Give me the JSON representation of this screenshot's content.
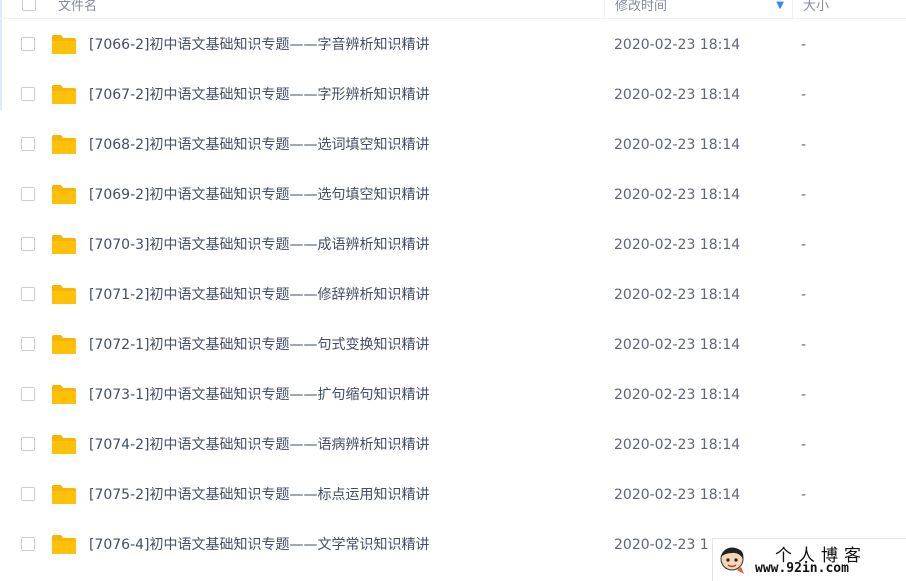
{
  "header": {
    "name_label": "文件名",
    "mtime_label": "修改时间",
    "size_label": "大小",
    "sort_icon": "sort-down-icon"
  },
  "colors": {
    "folder": "#ffc107",
    "folder_back": "#f7b500",
    "text": "#424e67",
    "accent": "#2d8cf0"
  },
  "files": [
    {
      "name": "[7066-2]初中语文基础知识专题——字音辨析知识精讲",
      "mtime": "2020-02-23 18:14",
      "size": "-"
    },
    {
      "name": "[7067-2]初中语文基础知识专题——字形辨析知识精讲",
      "mtime": "2020-02-23 18:14",
      "size": "-"
    },
    {
      "name": "[7068-2]初中语文基础知识专题——选词填空知识精讲",
      "mtime": "2020-02-23 18:14",
      "size": "-"
    },
    {
      "name": "[7069-2]初中语文基础知识专题——选句填空知识精讲",
      "mtime": "2020-02-23 18:14",
      "size": "-"
    },
    {
      "name": "[7070-3]初中语文基础知识专题——成语辨析知识精讲",
      "mtime": "2020-02-23 18:14",
      "size": "-"
    },
    {
      "name": "[7071-2]初中语文基础知识专题——修辞辨析知识精讲",
      "mtime": "2020-02-23 18:14",
      "size": "-"
    },
    {
      "name": "[7072-1]初中语文基础知识专题——句式变换知识精讲",
      "mtime": "2020-02-23 18:14",
      "size": "-"
    },
    {
      "name": "[7073-1]初中语文基础知识专题——扩句缩句知识精讲",
      "mtime": "2020-02-23 18:14",
      "size": "-"
    },
    {
      "name": "[7074-2]初中语文基础知识专题——语病辨析知识精讲",
      "mtime": "2020-02-23 18:14",
      "size": "-"
    },
    {
      "name": "[7075-2]初中语文基础知识专题——标点运用知识精讲",
      "mtime": "2020-02-23 18:14",
      "size": "-"
    },
    {
      "name": "[7076-4]初中语文基础知识专题——文学常识知识精讲",
      "mtime": "2020-02-23 1",
      "size": "-"
    }
  ],
  "watermark": {
    "title": "个人博客",
    "url": "www.92in.com"
  }
}
